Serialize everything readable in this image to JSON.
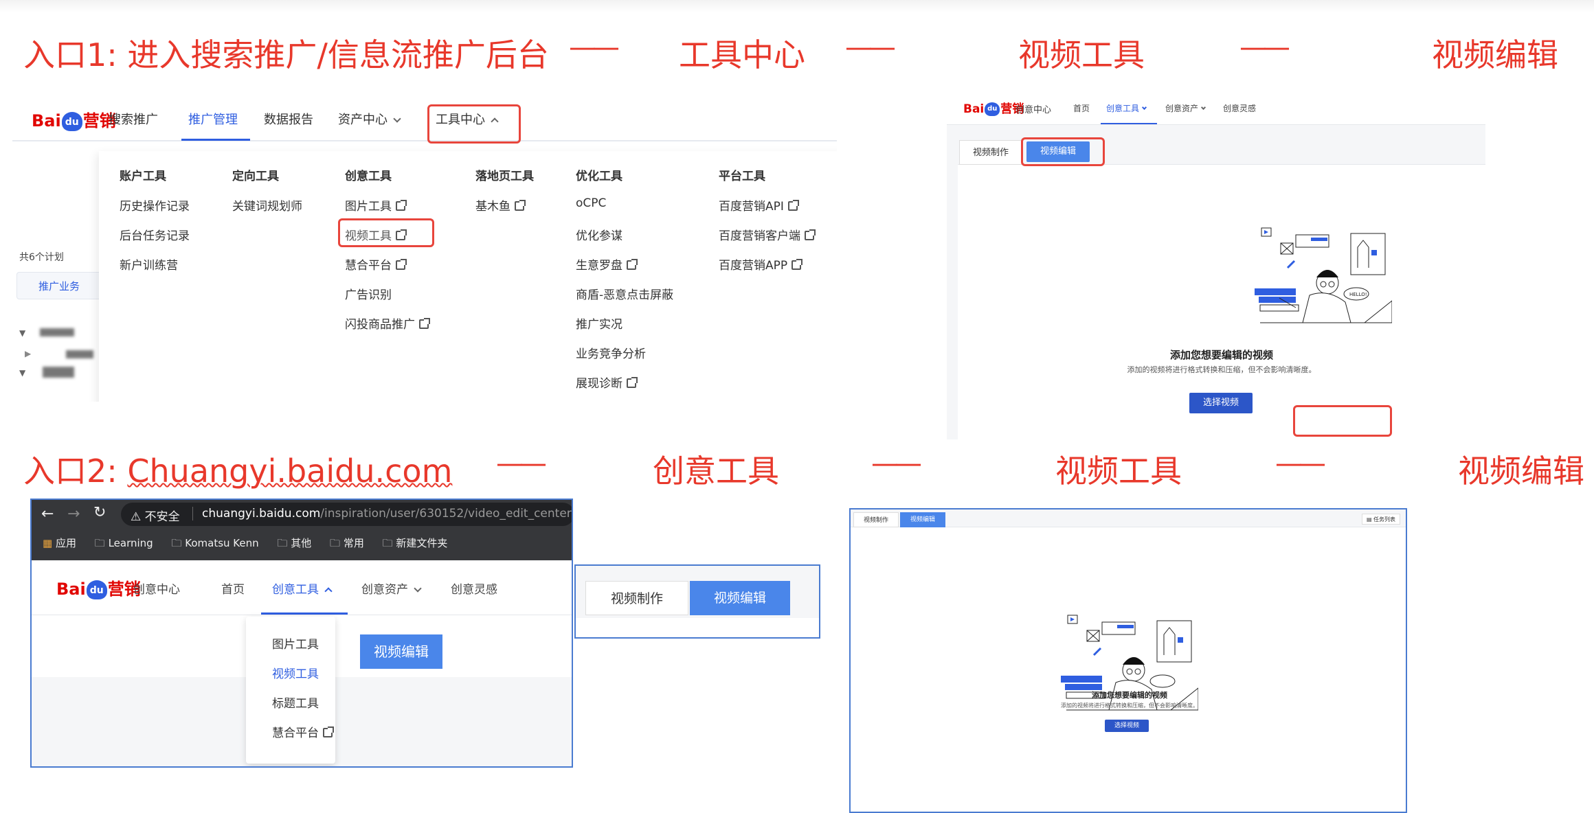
{
  "entry1": {
    "title": "入口1: 进入搜索推广/信息流推广后台",
    "dash": "——",
    "step1": "工具中心",
    "step2": "视频工具",
    "step3": "视频编辑"
  },
  "entry2": {
    "title_prefix": "入口2: ",
    "title_link": "Chuangyi.baidu.com",
    "dash": "——",
    "step1": "创意工具",
    "step2": "视频工具",
    "step3": "视频编辑"
  },
  "logo": {
    "bai": "Bai",
    "du": "du",
    "brand": "营销"
  },
  "shot1": {
    "nav": [
      "搜索推广",
      "推广管理",
      "数据报告",
      "资产中心",
      "工具中心"
    ],
    "left_panel": {
      "count": "共6个计划",
      "tab": "推广业务"
    },
    "menu_columns": [
      {
        "head": "账户工具",
        "items": [
          "历史操作记录",
          "后台任务记录",
          "新户训练营"
        ]
      },
      {
        "head": "定向工具",
        "items": [
          "关键词规划师"
        ]
      },
      {
        "head": "创意工具",
        "items": [
          "图片工具",
          "视频工具",
          "慧合平台",
          "广告识别",
          "闪投商品推广"
        ]
      },
      {
        "head": "落地页工具",
        "items": [
          "基木鱼"
        ]
      },
      {
        "head": "优化工具",
        "items": [
          "oCPC",
          "优化参谋",
          "生意罗盘",
          "商盾-恶意点击屏蔽",
          "推广实况",
          "业务竞争分析",
          "展现诊断"
        ]
      },
      {
        "head": "平台工具",
        "items": [
          "百度营销API",
          "百度营销客户端",
          "百度营销APP"
        ]
      }
    ]
  },
  "shot2": {
    "subtitle": "创意中心",
    "nav": [
      "首页",
      "创意工具",
      "创意资产",
      "创意灵感"
    ],
    "tabs": [
      "视频制作",
      "视频编辑"
    ],
    "empty_title": "添加您想要编辑的视频",
    "empty_desc": "添加的视频将进行格式转换和压缩，但不会影响清晰度。",
    "button": "选择视频",
    "hello": "HELLO!"
  },
  "shot3": {
    "browser": {
      "insecure": "不安全",
      "url_host": "chuangyi.baidu.com",
      "url_path": "/inspiration/user/630152/video_edit_center",
      "bookmarks": [
        "应用",
        "Learning",
        "Komatsu Kenn",
        "其他",
        "常用",
        "新建文件夹"
      ]
    },
    "subtitle": "创意中心",
    "nav": [
      "首页",
      "创意工具",
      "创意资产",
      "创意灵感"
    ],
    "dropdown": [
      "图片工具",
      "视频工具",
      "标题工具",
      "慧合平台"
    ],
    "behind_button": "视频编辑"
  },
  "shot4": {
    "tabs": [
      "视频制作",
      "视频编辑"
    ]
  },
  "shot5": {
    "tabs": [
      "视频制作",
      "视频编辑"
    ],
    "task_list": "任务列表",
    "empty_title": "添加您想要编辑的视频",
    "empty_desc": "添加的视频将进行格式转换和压缩，但不会影响清晰度。",
    "button": "选择视频"
  },
  "colors": {
    "accent_red": "#e8382b",
    "brand_blue": "#2f5ee0",
    "button_blue": "#2c56c8"
  }
}
